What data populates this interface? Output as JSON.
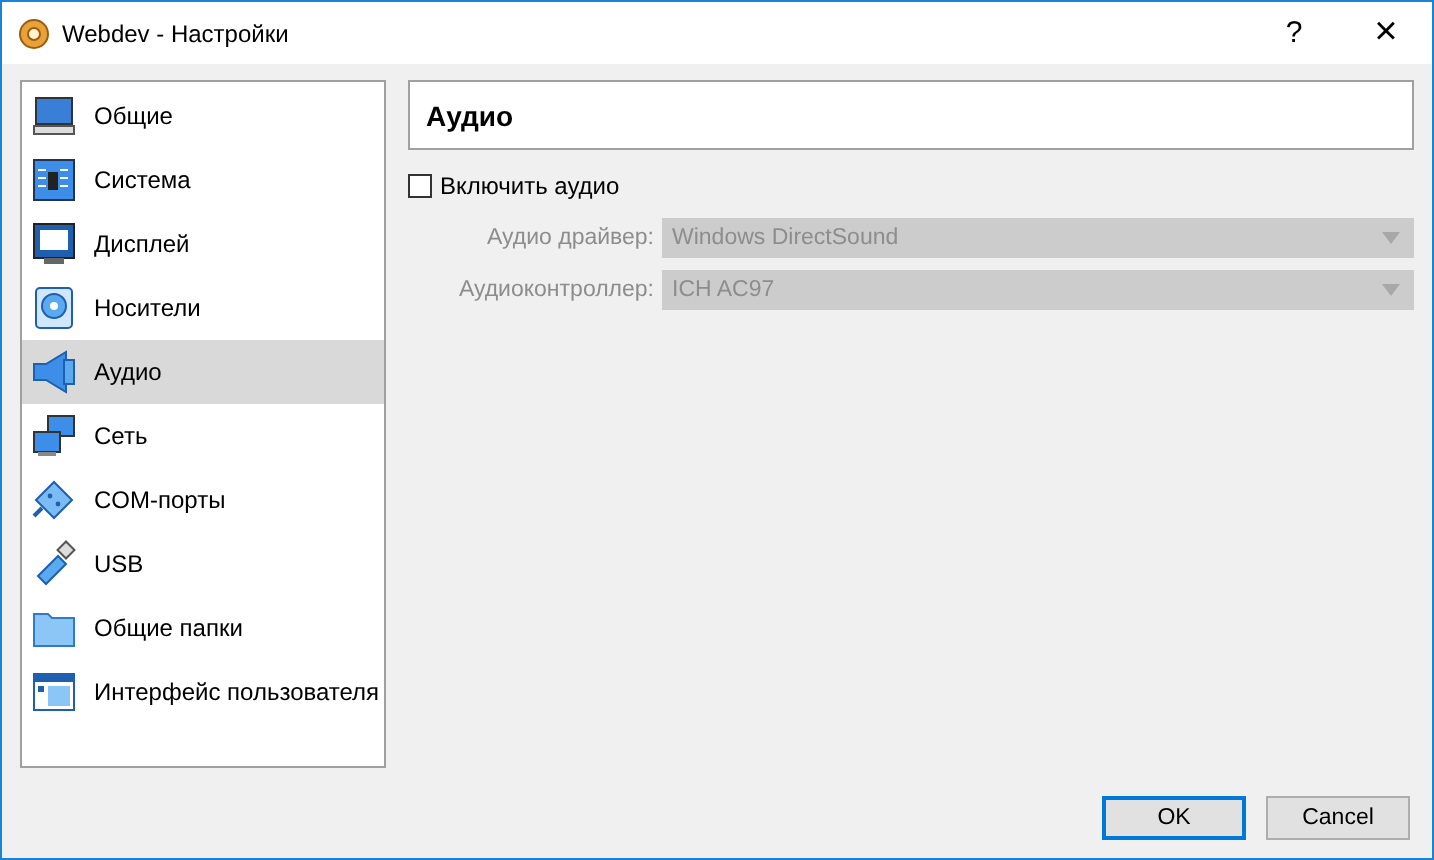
{
  "window": {
    "title": "Webdev - Настройки",
    "help_button": "?",
    "close_button": "×"
  },
  "sidebar": {
    "items": [
      {
        "label": "Общие",
        "selected": false
      },
      {
        "label": "Система",
        "selected": false
      },
      {
        "label": "Дисплей",
        "selected": false
      },
      {
        "label": "Носители",
        "selected": false
      },
      {
        "label": "Аудио",
        "selected": true
      },
      {
        "label": "Сеть",
        "selected": false
      },
      {
        "label": "COM-порты",
        "selected": false
      },
      {
        "label": "USB",
        "selected": false
      },
      {
        "label": "Общие папки",
        "selected": false
      },
      {
        "label": "Интерфейс пользователя",
        "selected": false
      }
    ]
  },
  "page": {
    "title": "Аудио",
    "enable_checkbox": {
      "label": "Включить аудио",
      "checked": false
    },
    "fields": [
      {
        "label": "Аудио драйвер:",
        "value": "Windows DirectSound",
        "disabled": true
      },
      {
        "label": "Аудиоконтроллер:",
        "value": "ICH AC97",
        "disabled": true
      }
    ]
  },
  "buttons": [
    {
      "label": "OK",
      "default": true
    },
    {
      "label": "Cancel",
      "default": false
    }
  ]
}
